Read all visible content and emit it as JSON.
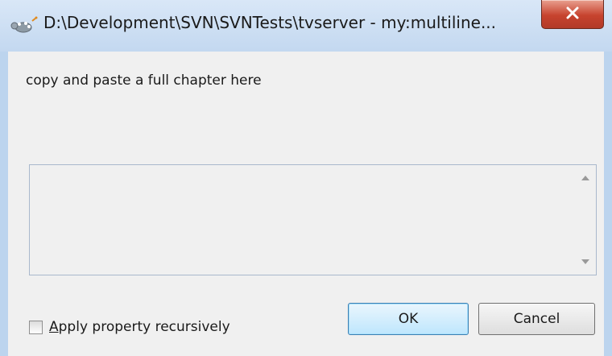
{
  "window": {
    "title": "D:\\Development\\SVN\\SVNTests\\tvserver - my:multiline..."
  },
  "dialog": {
    "prompt": "copy and paste a full chapter here",
    "textarea_value": "",
    "checkbox": {
      "checked": false,
      "label_first": "A",
      "label_rest": "pply property recursively"
    },
    "ok_label": "OK",
    "cancel_label": "Cancel"
  },
  "icons": {
    "app": "tortoisesvn-icon",
    "close": "close-icon",
    "scroll_up": "scroll-up-arrow-icon",
    "scroll_down": "scroll-down-arrow-icon"
  },
  "colors": {
    "titlebar": "#c3d8f0",
    "close_button": "#c7432e",
    "default_button_border": "#3c7fb1",
    "client_background": "#f0f0f0"
  }
}
